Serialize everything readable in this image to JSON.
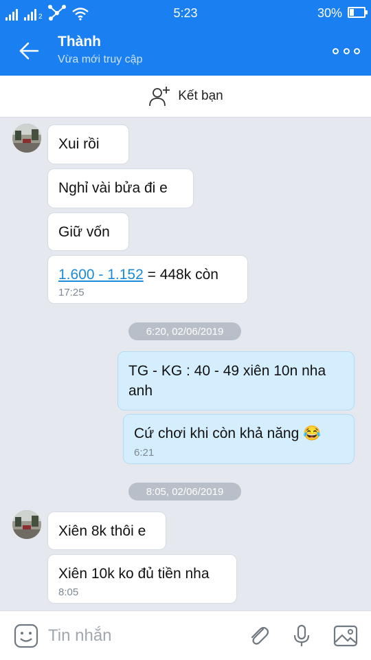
{
  "status_bar": {
    "time": "5:23",
    "battery_pct": "30%",
    "battery_level": 0.3,
    "sim_labels": [
      "",
      "2"
    ]
  },
  "header": {
    "name": "Thành",
    "subtitle": "Vừa mới truy cập"
  },
  "friend_bar": {
    "label": "Kết bạn"
  },
  "messages": {
    "m1": "Xui rồi",
    "m2": "Nghỉ vài bửa đi e",
    "m3": "Giữ vốn",
    "m4": {
      "link": "1.600 - 1.152",
      "rest": " = 448k còn",
      "time": "17:25"
    },
    "sep1": "6:20, 02/06/2019",
    "m5": "TG - KG : 40 - 49 xiên 10n nha anh",
    "m6": {
      "text": "Cứ chơi khi còn khả năng",
      "emoji": "😂",
      "time": "6:21"
    },
    "sep2": "8:05, 02/06/2019",
    "m7": "Xiên 8k thôi e",
    "m8": {
      "text": "Xiên 10k ko đủ tiền nha",
      "time": "8:05"
    }
  },
  "input": {
    "placeholder": "Tin nhắn"
  },
  "colors": {
    "header": "#1a7ff0",
    "outgoing_bubble": "#d4eefe",
    "incoming_bubble": "#ffffff",
    "link": "#1a8ad8",
    "background": "#e5e9ef"
  }
}
